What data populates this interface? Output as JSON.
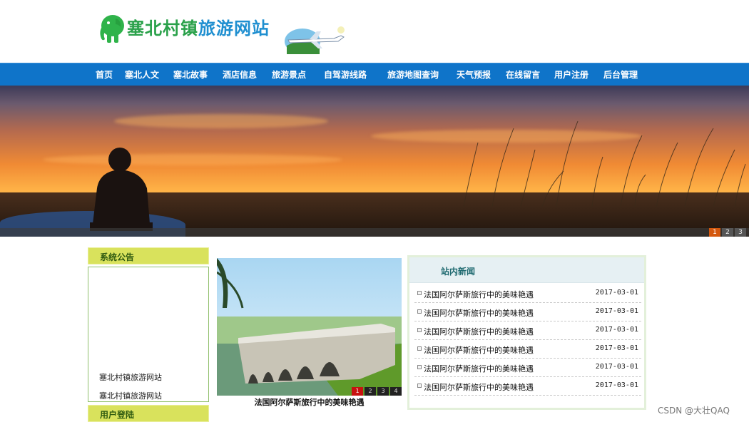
{
  "site": {
    "title_part1": "塞北村镇",
    "title_part2": "旅游网站"
  },
  "nav": {
    "items": [
      {
        "label": "首页"
      },
      {
        "label": "塞北人文"
      },
      {
        "label": "塞北故事"
      },
      {
        "label": "酒店信息"
      },
      {
        "label": "旅游景点"
      },
      {
        "label": "自驾游线路"
      },
      {
        "label": "旅游地图查询"
      },
      {
        "label": "天气预报"
      },
      {
        "label": "在线留言"
      },
      {
        "label": "用户注册"
      },
      {
        "label": "后台管理"
      }
    ]
  },
  "banner": {
    "pager": [
      "1",
      "2",
      "3"
    ],
    "active_page": "1"
  },
  "sidebar": {
    "announcement_title": "系统公告",
    "links": [
      "塞北村镇旅游网站",
      "塞北村镇旅游网站"
    ],
    "login_title": "用户登陆"
  },
  "slideshow": {
    "caption": "法国阿尔萨斯旅行中的美味艳遇",
    "pager": [
      "1",
      "2",
      "3",
      "4"
    ],
    "active_page": "1"
  },
  "news": {
    "title": "站内新闻",
    "items": [
      {
        "title": "法国阿尔萨斯旅行中的美味艳遇",
        "date": "2017-03-01"
      },
      {
        "title": "法国阿尔萨斯旅行中的美味艳遇",
        "date": "2017-03-01"
      },
      {
        "title": "法国阿尔萨斯旅行中的美味艳遇",
        "date": "2017-03-01"
      },
      {
        "title": "法国阿尔萨斯旅行中的美味艳遇",
        "date": "2017-03-01"
      },
      {
        "title": "法国阿尔萨斯旅行中的美味艳遇",
        "date": "2017-03-01"
      },
      {
        "title": "法国阿尔萨斯旅行中的美味艳遇",
        "date": "2017-03-01"
      }
    ]
  },
  "watermark": "CSDN @大壮QAQ",
  "colors": {
    "nav_bg": "#0f74c9",
    "side_head_bg": "#d9e25c",
    "active_dot": "#d4580e"
  }
}
